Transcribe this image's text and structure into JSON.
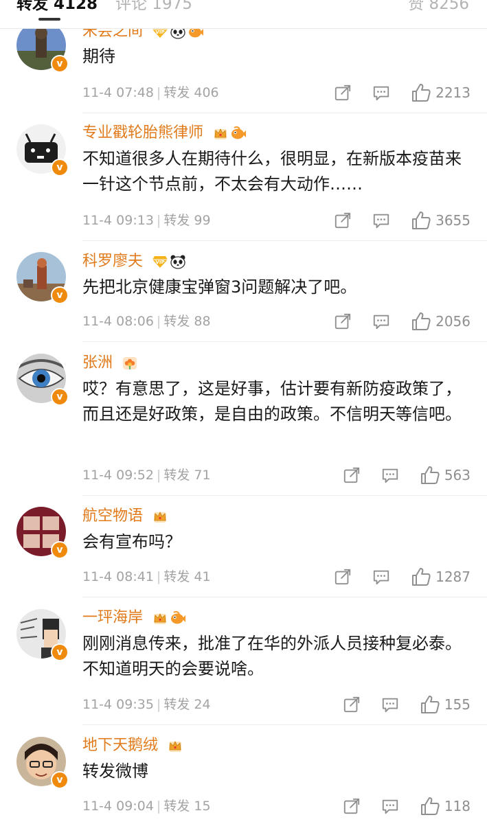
{
  "tabs": {
    "repost": "转发 4128",
    "comment": "评论 1975",
    "like": "赞 8256"
  },
  "colors": {
    "username": "#e07a1a",
    "verified_badge": "#f08a0c",
    "meta": "#a3a3a3"
  },
  "comments": [
    {
      "username": "米芸之间",
      "text": "期待",
      "time": "11-4 07:48",
      "repost": "转发 406",
      "likes": "2213",
      "badges": [
        "vip-diamond-icon",
        "panda-icon",
        "fish-icon"
      ]
    },
    {
      "username": "专业戳轮胎熊律师",
      "text": "不知道很多人在期待什么，很明显，在新版本疫苗来一针这个节点前，不太会有大动作……",
      "time": "11-4 09:13",
      "repost": "转发 99",
      "likes": "3655",
      "badges": [
        "crown-icon",
        "fish-icon"
      ]
    },
    {
      "username": "科罗廖夫",
      "text": "先把北京健康宝弹窗3问题解决了吧。",
      "time": "11-4 08:06",
      "repost": "转发 88",
      "likes": "2056",
      "badges": [
        "vip-diamond-icon",
        "panda-icon"
      ]
    },
    {
      "username": "张洲",
      "text": "哎？有意思了，这是好事，估计要有新防疫政策了，而且还是好政策，是自由的政策。不信明天等信吧。",
      "time": "11-4 09:52",
      "repost": "转发 71",
      "likes": "563",
      "badges": [
        "flower-icon"
      ]
    },
    {
      "username": "航空物语",
      "text": "会有宣布吗？",
      "time": "11-4 08:41",
      "repost": "转发 41",
      "likes": "1287",
      "badges": [
        "crown-icon"
      ]
    },
    {
      "username": "一玶海岸",
      "text": "刚刚消息传来，批准了在华的外派人员接种复必泰。不知道明天的会要说啥。",
      "time": "11-4 09:35",
      "repost": "转发 24",
      "likes": "155",
      "badges": [
        "crown-icon",
        "fish-icon"
      ]
    },
    {
      "username": "地下天鹅绒",
      "text": "转发微博",
      "time": "11-4 09:04",
      "repost": "转发 15",
      "likes": "118",
      "badges": [
        "crown-icon"
      ]
    }
  ]
}
